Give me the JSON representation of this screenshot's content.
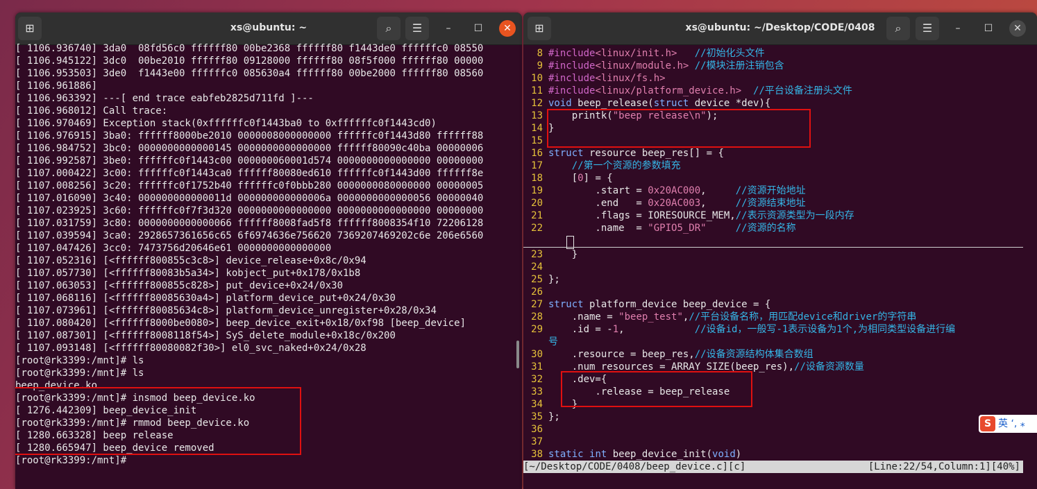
{
  "left_window": {
    "title": "xs@ubuntu: ~",
    "lines": [
      "[ 1106.936740] 3da0  08fd56c0 ffffff80 00be2368 ffffff80 f1443de0 ffffffc0 08550",
      "[ 1106.945122] 3dc0  00be2010 ffffff80 09128000 ffffff80 08f5f000 ffffff80 00000",
      "[ 1106.953503] 3de0  f1443e00 ffffffc0 085630a4 ffffff80 00be2000 ffffff80 08560",
      "[ 1106.961886]",
      "[ 1106.963392] ---[ end trace eabfeb2825d711fd ]---",
      "[ 1106.968012] Call trace:",
      "[ 1106.970469] Exception stack(0xffffffc0f1443ba0 to 0xffffffc0f1443cd0)",
      "[ 1106.976915] 3ba0: ffffff8000be2010 0000008000000000 ffffffc0f1443d80 ffffff88",
      "[ 1106.984752] 3bc0: 0000000000000145 0000000000000000 ffffff80090c40ba 00000006",
      "[ 1106.992587] 3be0: ffffffc0f1443c00 000000060001d574 0000000000000000 00000000",
      "[ 1107.000422] 3c00: ffffffc0f1443ca0 ffffff80080ed610 ffffffc0f1443d00 ffffff8e",
      "[ 1107.008256] 3c20: ffffffc0f1752b40 ffffffc0f0bbb280 0000000080000000 00000005",
      "[ 1107.016090] 3c40: 000000000000011d 000000000000006a 0000000000000056 00000040",
      "[ 1107.023925] 3c60: ffffffc0f7f3d320 0000000000000000 0000000000000000 00000000",
      "[ 1107.031759] 3c80: 0000000000000066 ffffff8008fad5f8 ffffff8008354f10 72206128",
      "[ 1107.039594] 3ca0: 2928657361656c65 6f6974636e756620 7369207469202c6e 206e6560",
      "[ 1107.047426] 3cc0: 7473756d20646e61 0000000000000000",
      "[ 1107.052316] [<ffffff800855c3c8>] device_release+0x8c/0x94",
      "[ 1107.057730] [<ffffff80083b5a34>] kobject_put+0x178/0x1b8",
      "[ 1107.063053] [<ffffff800855c828>] put_device+0x24/0x30",
      "[ 1107.068116] [<ffffff80085630a4>] platform_device_put+0x24/0x30",
      "[ 1107.073961] [<ffffff80085634c8>] platform_device_unregister+0x28/0x34",
      "[ 1107.080420] [<ffffff8000be0080>] beep_device_exit+0x18/0xf98 [beep_device]",
      "[ 1107.087301] [<ffffff8008118f54>] SyS_delete_module+0x18c/0x200",
      "[ 1107.093148] [<ffffff80080082f30>] el0_svc_naked+0x24/0x28",
      "[root@rk3399:/mnt]# ls",
      "[root@rk3399:/mnt]# ls",
      "beep_device.ko",
      "[root@rk3399:/mnt]# insmod beep_device.ko",
      "[ 1276.442309] beep_device_init",
      "[root@rk3399:/mnt]# rmmod beep_device.ko",
      "[ 1280.663328] beep release",
      "[ 1280.665947] beep_device removed",
      "[root@rk3399:/mnt]# "
    ]
  },
  "right_window": {
    "title": "xs@ubuntu: ~/Desktop/CODE/0408",
    "status_left": "[~/Desktop/CODE/0408/beep_device.c][c]",
    "status_right": "[Line:22/54,Column:1][40%]",
    "ime_label": "英"
  },
  "icons": {
    "new_tab": "new-tab-icon",
    "search": "search-icon",
    "menu": "hamburger-menu-icon",
    "minimize": "minimize-icon",
    "maximize": "maximize-icon",
    "close": "close-icon"
  },
  "colors": {
    "terminal_bg": "#300a24",
    "titlebar": "#303030",
    "highlight_box": "#e01010",
    "line_number": "#e6c23a",
    "comment": "#35b5e6",
    "keyword": "#7fb0ff",
    "string": "#e07fae"
  }
}
